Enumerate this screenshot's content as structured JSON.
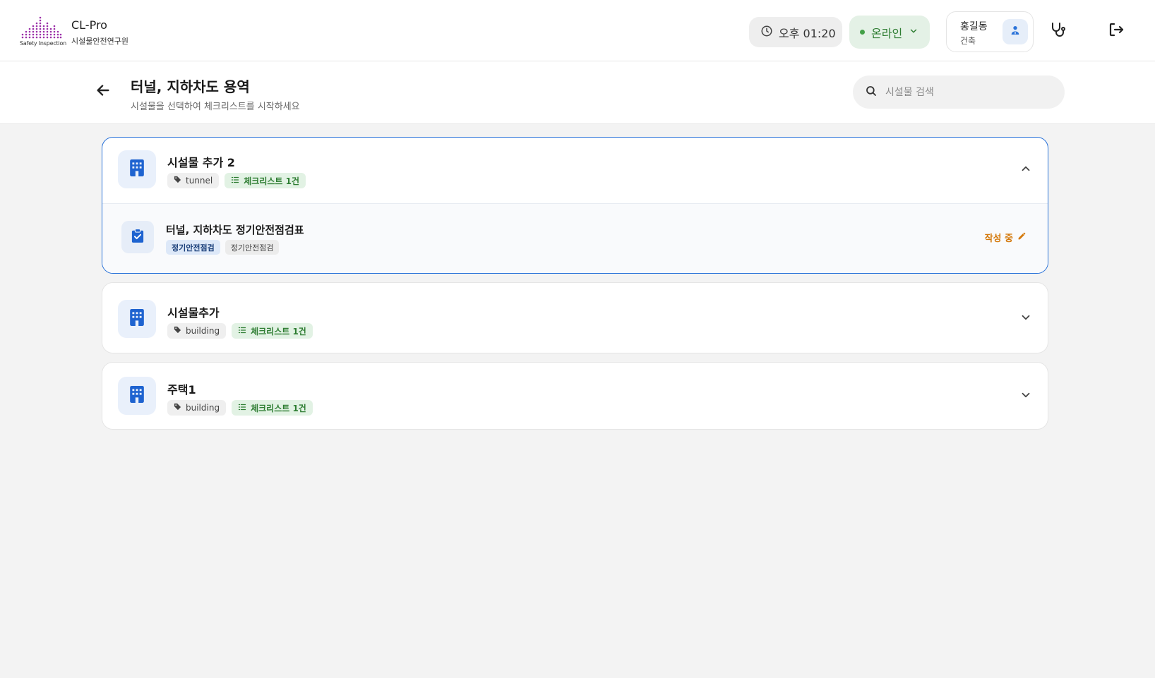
{
  "app": {
    "name": "CL-Pro",
    "org": "시설물안전연구원",
    "logo_caption": "Safety Inspection"
  },
  "topbar": {
    "time": "오후 01:20",
    "status": "온라인",
    "user": {
      "name": "홍길동",
      "role": "건축"
    }
  },
  "page": {
    "title": "터널, 지하차도 용역",
    "subtitle": "시설물을 선택하여 체크리스트를 시작하세요"
  },
  "search": {
    "placeholder": "시설물 검색"
  },
  "facilities": [
    {
      "name": "시설물 추가 2",
      "type": "tunnel",
      "checklist_count": "체크리스트 1건",
      "expanded": true,
      "checklists": [
        {
          "title": "터널, 지하차도 정기안전점검표",
          "tags": [
            "정기안전점검",
            "정기안전점검"
          ],
          "status": "작성 중"
        }
      ]
    },
    {
      "name": "시설물추가",
      "type": "building",
      "checklist_count": "체크리스트 1건",
      "expanded": false
    },
    {
      "name": "주택1",
      "type": "building",
      "checklist_count": "체크리스트 1건",
      "expanded": false
    }
  ],
  "icons": {
    "clock": "clock-icon",
    "chevron": "chevron-down-icon",
    "avatar": "user-icon",
    "stethoscope": "stethoscope-icon",
    "logout": "logout-icon",
    "back": "arrow-left-icon",
    "search": "search-icon",
    "building": "building-icon",
    "tag": "tag-icon",
    "list": "list-icon",
    "clipboard": "clipboard-check-icon",
    "pencil": "pencil-icon"
  },
  "colors": {
    "accent": "#2a73d9",
    "online": "#2e7d32",
    "status_in_progress": "#d4780a",
    "logo": "#9b2fa8"
  }
}
